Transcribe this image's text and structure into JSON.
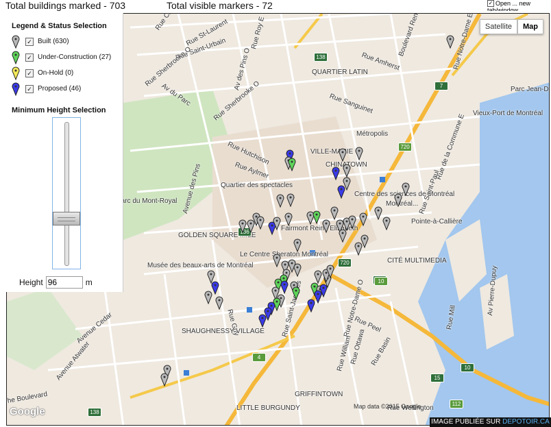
{
  "header": {
    "total_marked": "Total buildings marked - 703",
    "total_visible": "Total visible markers - 72"
  },
  "corner_option": {
    "checked": true,
    "label": "Open ... new tab/window"
  },
  "map_type": {
    "satellite": "Satellite",
    "map": "Map",
    "active": "Map"
  },
  "legend": {
    "title": "Legend & Status Selection",
    "items": [
      {
        "label": "Built (630)",
        "checked": true,
        "color": "#b9b9b9"
      },
      {
        "label": "Under-Construction (27)",
        "checked": true,
        "color": "#5fd35a"
      },
      {
        "label": "On-Hold (0)",
        "checked": true,
        "color": "#f2e95a"
      },
      {
        "label": "Proposed (46)",
        "checked": true,
        "color": "#3b3be8"
      }
    ]
  },
  "height_filter": {
    "title": "Minimum Height Selection",
    "label": "Height",
    "value": "96",
    "unit": "m",
    "slider_fraction": 0.3
  },
  "map_labels": [
    "Rue Clark",
    "Rue St-Laurent",
    "Rue Saint-Urbain",
    "Av du Parc",
    "Rue Roy E",
    "Av des Pins O",
    "Rue Sherbrooke O",
    "Rue Sanguinet",
    "Rue Amherst",
    "QUARTIER LATIN",
    "Boulevard René-Lévesque E",
    "Rue Notre-Dame E",
    "Parc Jean-D",
    "Vieux-Port de Montréal",
    "Métropolis",
    "VILLE-MARIE",
    "CHINATOWN",
    "Rue Hutchison",
    "Rue Aylmer",
    "Quartier des spectacles",
    "Parc du Mont-Royal",
    "Avenue des Pins",
    "Centre des sciences de Montréal",
    "Montréal...",
    "Pointe-à-Callière",
    "GOLDEN SQUARE MILE",
    "Fairmont Reine Elizabeth",
    "Le Centre Sheraton Montréal",
    "Musée des beaux-arts de Montréal",
    "CITÉ MULTIMEDIA",
    "Rue Guy",
    "SHAUGHNESSY VILLAGE",
    "Rue Saint-Jacques",
    "Rue Peel",
    "Rue Notre-Dame O",
    "GRIFFINTOWN",
    "LITTLE BURGUNDY",
    "Avenue Cedar",
    "Rue Sherbrooke O",
    "he Boulevard",
    "Avenue Atwater",
    "Rue Ottawa",
    "Rue William",
    "Rue Basin",
    "Rue Mill",
    "Av Pierre-Dupuy",
    "Rue Wellington",
    "Rue de la Commune E",
    "Rue Saint-Paul"
  ],
  "road_shields": [
    "138",
    "720",
    "10",
    "720",
    "10",
    "7",
    "136",
    "4",
    "15",
    "10",
    "112",
    "138"
  ],
  "attribution": "Map data ©2015 Google",
  "google_logo": "Google",
  "watermark": {
    "prefix": "IMAGE PUBLIÉE SUR ",
    "site": "DEPOTOIR.CA"
  },
  "marker_colors": {
    "built": "#b9b9b9",
    "construction": "#5fd35a",
    "proposed": "#3b3be8"
  },
  "icons": [
    "marker-pin-icon",
    "checkbox-icon",
    "zoom-slider-icon"
  ]
}
